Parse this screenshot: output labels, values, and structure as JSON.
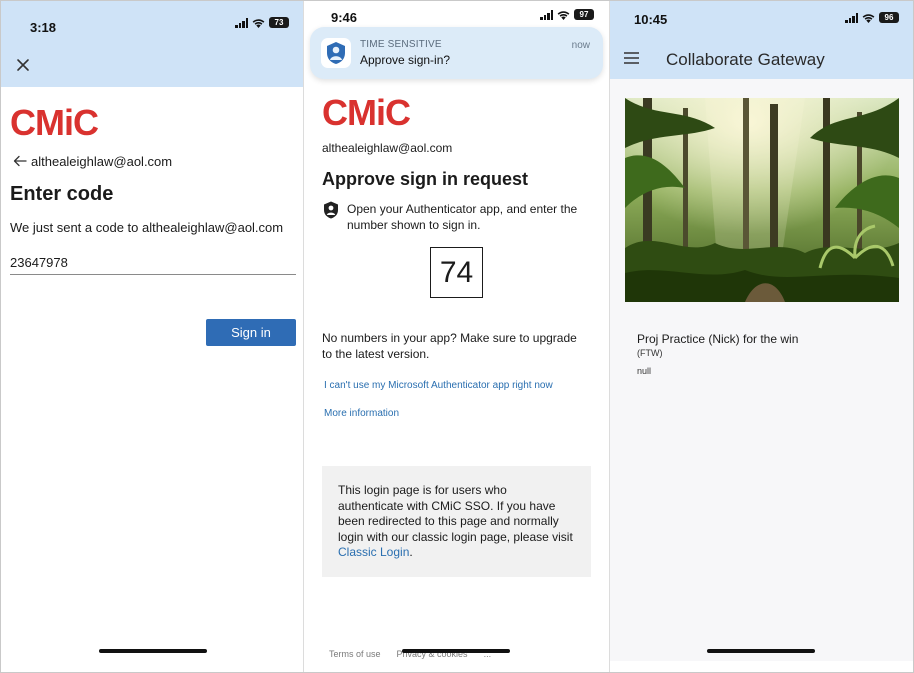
{
  "screen1": {
    "status": {
      "time": "3:18",
      "battery": "73"
    },
    "logo": "CMiC",
    "email": "althealeighlaw@aol.com",
    "title": "Enter code",
    "description": "We just sent a code to althealeighlaw@aol.com",
    "code_value": "23647978",
    "signin_label": "Sign in",
    "icons": [
      "close-icon",
      "back-arrow-icon"
    ]
  },
  "screen2": {
    "status": {
      "time": "9:46",
      "battery": "97"
    },
    "notification": {
      "kind": "TIME SENSITIVE",
      "message": "Approve sign-in?",
      "when": "now"
    },
    "logo": "CMiC",
    "email": "althealeighlaw@aol.com",
    "title": "Approve sign in request",
    "instruction": "Open your Authenticator app, and enter the number shown to sign in.",
    "number": "74",
    "no_numbers": "No numbers in your app? Make sure to upgrade to the latest version.",
    "link_cant_use": "I can't use my Microsoft Authenticator app right now",
    "link_more": "More information",
    "info_text": "This login page is for users who authenticate with CMiC SSO. If you have been redirected to this page and normally login with our classic login page, please visit",
    "info_link": "Classic Login",
    "info_end": ".",
    "footer": {
      "terms": "Terms of use",
      "privacy": "Privacy & cookies",
      "more": "..."
    }
  },
  "screen3": {
    "status": {
      "time": "10:45",
      "battery": "96"
    },
    "app_title": "Collaborate Gateway",
    "card_title": "Proj Practice (Nick) for the win",
    "card_subtitle": "(FTW)",
    "card_extra": "null",
    "icons": [
      "menu-icon"
    ]
  },
  "colors": {
    "header_blue": "#cfe3f7",
    "brand_red": "#d9322f",
    "button_blue": "#2f6cb5",
    "link_blue": "#2a6fb0"
  }
}
